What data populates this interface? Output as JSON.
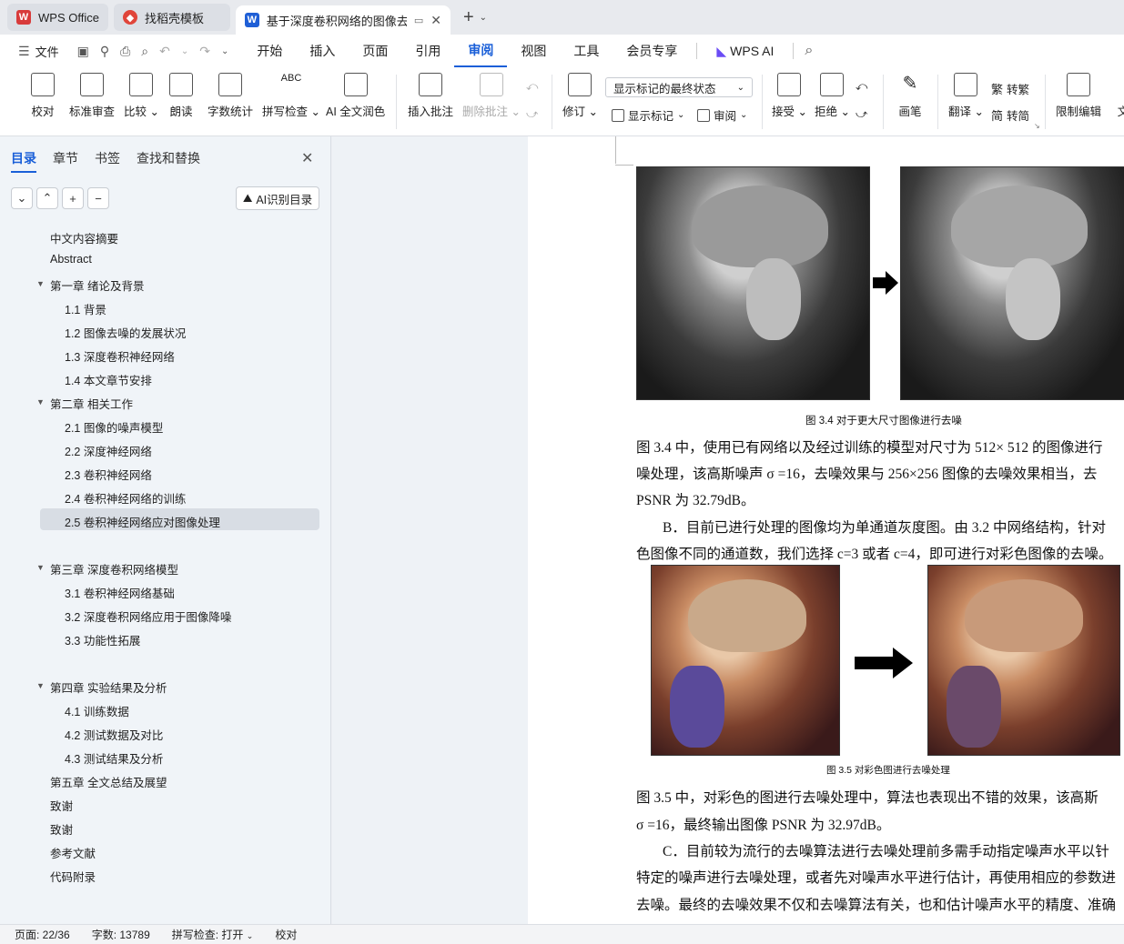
{
  "tabs": {
    "wps_office": "WPS Office",
    "templates": "找稻壳模板",
    "document": "基于深度卷积网络的图像去噪"
  },
  "menu": {
    "file": "文件",
    "items": [
      "开始",
      "插入",
      "页面",
      "引用",
      "审阅",
      "视图",
      "工具",
      "会员专享"
    ],
    "active": "审阅",
    "wps_ai": "WPS AI"
  },
  "ribbon": {
    "proofread": "校对",
    "standard_review": "标准审查",
    "compare": "比较",
    "read_aloud": "朗读",
    "word_count": "字数统计",
    "spell_check": "拼写检查",
    "ai_polish": "AI 全文润色",
    "insert_comment": "插入批注",
    "delete_comment": "删除批注",
    "track_changes": "修订",
    "display_select": "显示标记的最终状态",
    "show_markup": "显示标记",
    "review": "审阅",
    "accept": "接受",
    "reject": "拒绝",
    "pen": "画笔",
    "translate": "翻译",
    "to_traditional": "转繁",
    "to_simplified": "转简",
    "restrict_edit": "限制编辑",
    "more": "文"
  },
  "panel": {
    "tabs": [
      "目录",
      "章节",
      "书签",
      "查找和替换"
    ],
    "ai_toc": "AI识别目录",
    "toc": [
      {
        "text": "中文内容摘要",
        "level": 1,
        "caret": false
      },
      {
        "text": "Abstract",
        "level": 1,
        "caret": false
      },
      {
        "text": "第一章  绪论及背景",
        "level": 1,
        "caret": true
      },
      {
        "text": "1.1 背景",
        "level": 2,
        "caret": false
      },
      {
        "text": "1.2  图像去噪的发展状况",
        "level": 2,
        "caret": false
      },
      {
        "text": "1.3  深度卷积神经网络",
        "level": 2,
        "caret": false
      },
      {
        "text": "1.4  本文章节安排",
        "level": 2,
        "caret": false
      },
      {
        "text": "第二章  相关工作",
        "level": 1,
        "caret": true
      },
      {
        "text": "2.1 图像的噪声模型",
        "level": 2,
        "caret": false
      },
      {
        "text": "2.2 深度神经网络",
        "level": 2,
        "caret": false
      },
      {
        "text": "2.3 卷积神经网络",
        "level": 2,
        "caret": false
      },
      {
        "text": "2.4  卷积神经网络的训练",
        "level": 2,
        "caret": false
      },
      {
        "text": "2.5  卷积神经网络应对图像处理",
        "level": 2,
        "caret": false,
        "selected": true
      },
      {
        "text": "第三章  深度卷积网络模型",
        "level": 1,
        "caret": true
      },
      {
        "text": "3.1  卷积神经网络基础",
        "level": 2,
        "caret": false
      },
      {
        "text": "3.2  深度卷积网络应用于图像降噪",
        "level": 2,
        "caret": false
      },
      {
        "text": "3.3  功能性拓展",
        "level": 2,
        "caret": false
      },
      {
        "text": "第四章  实验结果及分析",
        "level": 1,
        "caret": true
      },
      {
        "text": "4.1  训练数据",
        "level": 2,
        "caret": false
      },
      {
        "text": "4.2  测试数据及对比",
        "level": 2,
        "caret": false
      },
      {
        "text": "4.3  测试结果及分析",
        "level": 2,
        "caret": false
      },
      {
        "text": "第五章  全文总结及展望",
        "level": 1,
        "caret": false
      },
      {
        "text": "致谢",
        "level": 1,
        "caret": false
      },
      {
        "text": "致谢",
        "level": 1,
        "caret": false
      },
      {
        "text": "参考文献",
        "level": 1,
        "caret": false
      },
      {
        "text": "代码附录",
        "level": 1,
        "caret": false
      }
    ]
  },
  "doc": {
    "fig34_caption": "图 3.4  对于更大尺寸图像进行去噪",
    "p1_l1": "图 3.4 中，使用已有网络以及经过训练的模型对尺寸为 512× 512 的图像进行",
    "p1_l2": "噪处理，该高斯噪声 σ =16，去噪效果与 256×256 图像的去噪效果相当，去",
    "p1_l3": "PSNR 为 32.79dB。",
    "p2_l1": "B．目前已进行处理的图像均为单通道灰度图。由 3.2 中网络结构，针对",
    "p2_l2": "色图像不同的通道数，我们选择 c=3 或者 c=4，即可进行对彩色图像的去噪。",
    "fig35_caption": "图 3.5  对彩色图进行去噪处理",
    "p3_l1": "图 3.5 中，对彩色的图进行去噪处理中，算法也表现出不错的效果，该高斯",
    "p3_l2": "σ =16，最终输出图像 PSNR 为 32.97dB。",
    "p4_l1": "C．目前较为流行的去噪算法进行去噪处理前多需手动指定噪声水平以针",
    "p4_l2": "特定的噪声进行去噪处理，或者先对噪声水平进行估计，再使用相应的参数进",
    "p4_l3": "去噪。最终的去噪效果不仅和去噪算法有关，也和估计噪声水平的精度、准确"
  },
  "status": {
    "page": "页面: 22/36",
    "words": "字数: 13789",
    "spell": "拼写检查: 打开",
    "proof": "校对"
  }
}
